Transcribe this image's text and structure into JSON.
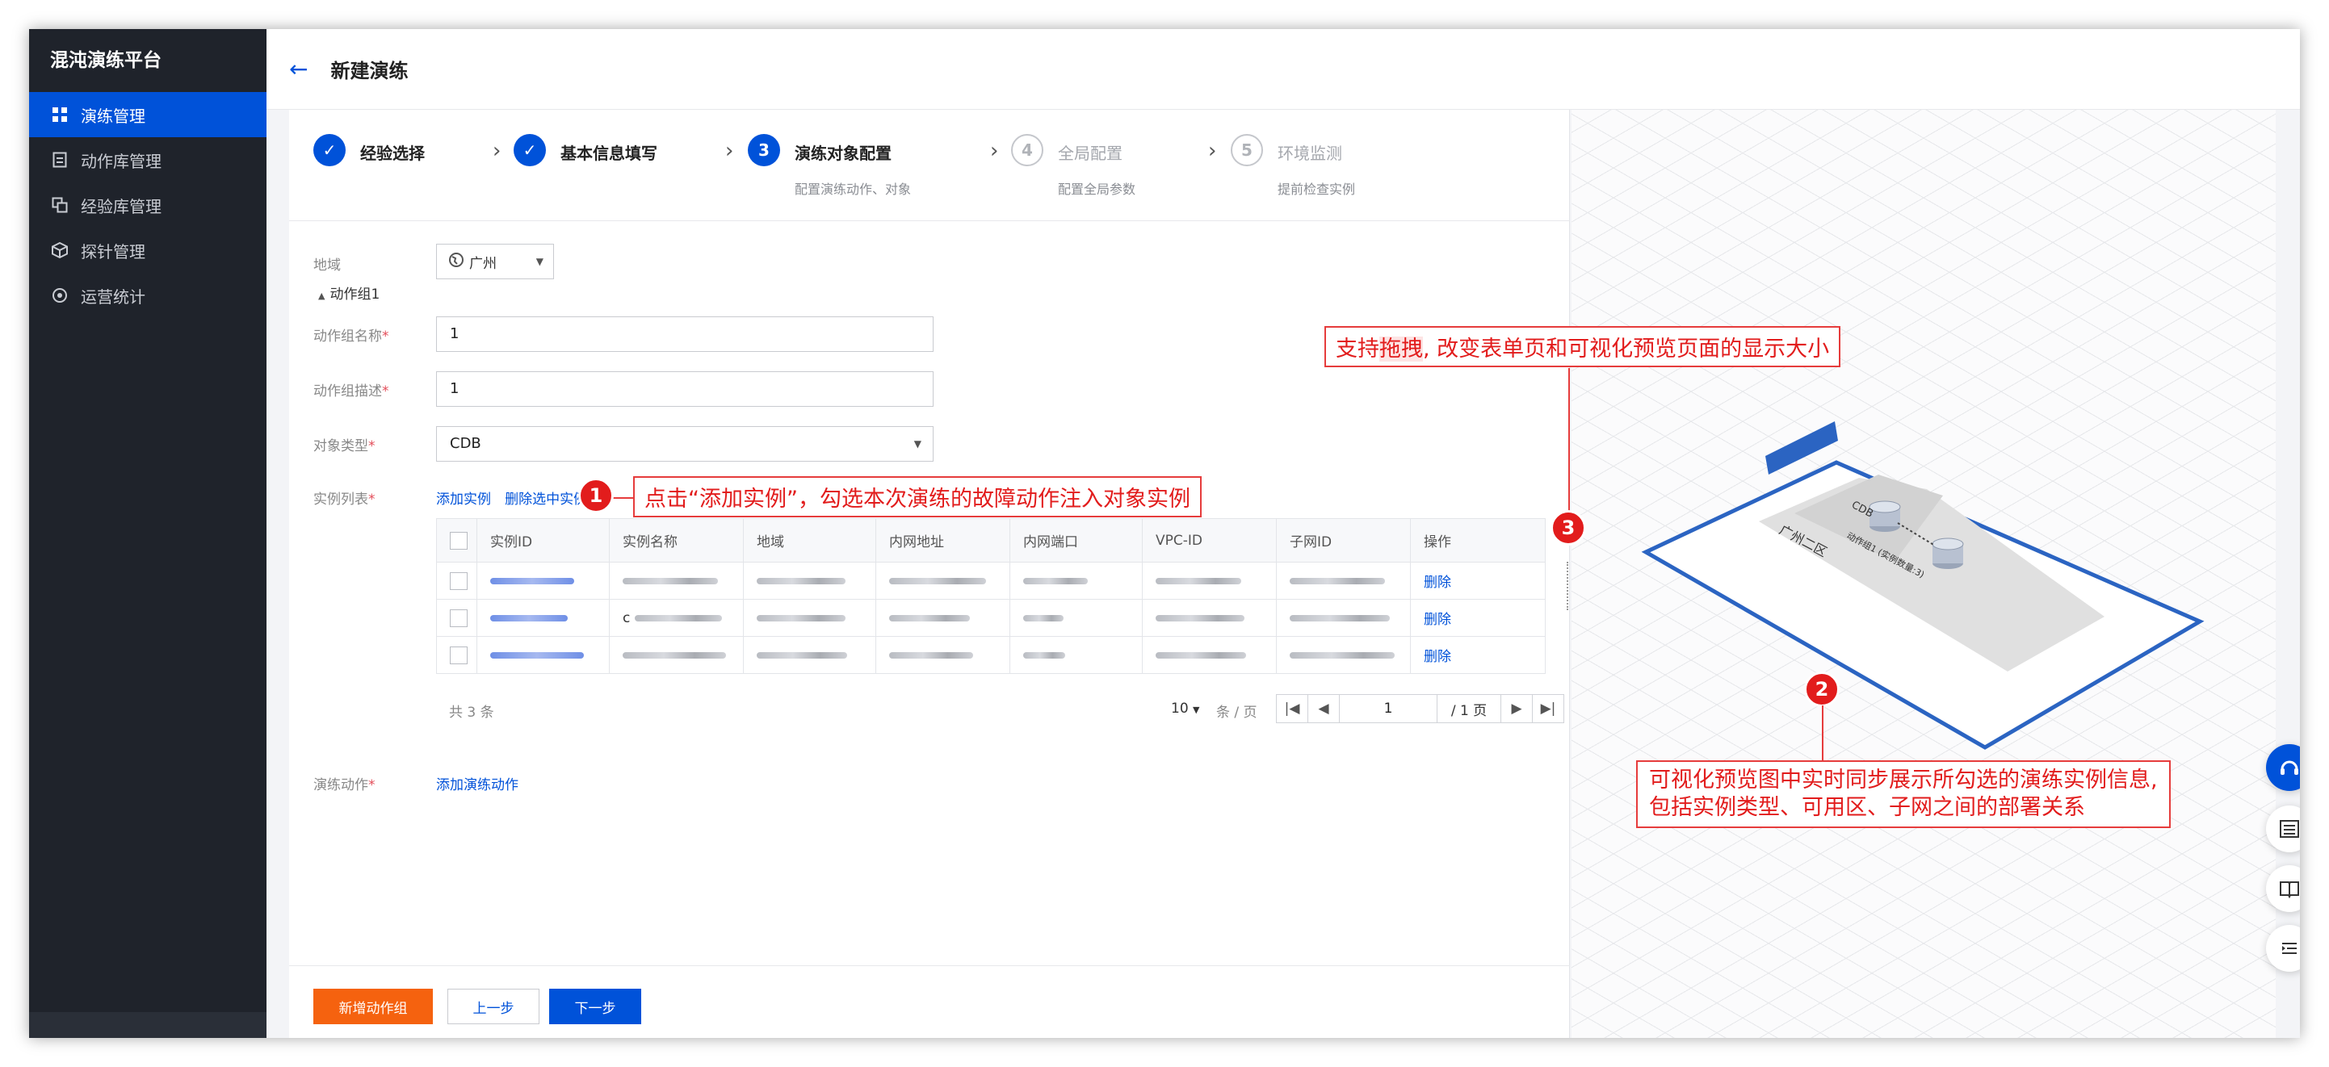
{
  "app": {
    "brand": "混沌演练平台",
    "page_title": "新建演练"
  },
  "sidebar": {
    "items": [
      {
        "label": "演练管理",
        "icon": "grid-icon",
        "active": true
      },
      {
        "label": "动作库管理",
        "icon": "document-icon",
        "active": false
      },
      {
        "label": "经验库管理",
        "icon": "copy-icon",
        "active": false
      },
      {
        "label": "探针管理",
        "icon": "cube-icon",
        "active": false
      },
      {
        "label": "运营统计",
        "icon": "target-icon",
        "active": false
      }
    ]
  },
  "steps": [
    {
      "num": "1",
      "title": "经验选择",
      "desc": "",
      "state": "done"
    },
    {
      "num": "2",
      "title": "基本信息填写",
      "desc": "",
      "state": "done"
    },
    {
      "num": "3",
      "title": "演练对象配置",
      "desc": "配置演练动作、对象",
      "state": "current"
    },
    {
      "num": "4",
      "title": "全局配置",
      "desc": "配置全局参数",
      "state": "todo"
    },
    {
      "num": "5",
      "title": "环境监测",
      "desc": "提前检查实例",
      "state": "todo"
    }
  ],
  "form": {
    "region_label": "地域",
    "region_value": "广州",
    "group_toggle": "动作组1",
    "group_name_label": "动作组名称",
    "group_name_value": "1",
    "group_desc_label": "动作组描述",
    "group_desc_value": "1",
    "object_type_label": "对象类型",
    "object_type_value": "CDB",
    "instance_list_label": "实例列表",
    "add_instance": "添加实例",
    "delete_selected": "删除选中实例",
    "drill_action_label": "演练动作",
    "add_drill_action": "添加演练动作"
  },
  "table": {
    "headers": [
      "实例ID",
      "实例名称",
      "地域",
      "内网地址",
      "内网端口",
      "VPC-ID",
      "子网ID",
      "操作"
    ],
    "rows": [
      {
        "action": "删除"
      },
      {
        "name_prefix": "c",
        "action": "删除"
      },
      {
        "action": "删除"
      }
    ],
    "total": "共 3 条",
    "page_size": "10",
    "page_size_unit": "条 / 页",
    "current_page": "1",
    "total_pages": "/ 1 页"
  },
  "buttons": {
    "add_group": "新增动作组",
    "prev": "上一步",
    "next": "下一步"
  },
  "preview": {
    "type_label": "CDB",
    "zone_label": "广州二区",
    "group_label": "动作组1 (实例数量:3)"
  },
  "annotations": [
    {
      "num": "1",
      "text": "点击“添加实例”，勾选本次演练的故障动作注入对象实例"
    },
    {
      "num": "2",
      "text_line1": "可视化预览图中实时同步展示所勾选的演练实例信息,",
      "text_line2": "包括实例类型、可用区、子网之间的部署关系"
    },
    {
      "num": "3",
      "text_before": "支持",
      "text_highlight": "拖拽",
      "text_after": ", 改变表单页和可视化预览页面的显示大小"
    }
  ],
  "colors": {
    "primary": "#0052d9",
    "sidebar": "#1f232b",
    "annotation": "#e21c1c",
    "orange": "#f5620f"
  }
}
